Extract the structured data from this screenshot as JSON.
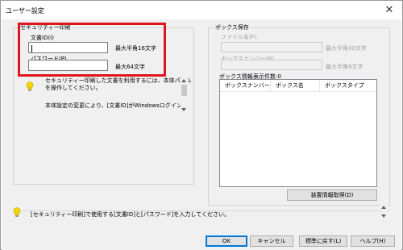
{
  "window": {
    "title": "ユーザー設定",
    "close_symbol": "✕"
  },
  "security_print": {
    "group_title": "セキュリティー印刷",
    "doc_id_label": "文書ID(I)",
    "doc_id_value": "",
    "doc_id_limit": "最大半角16文字",
    "password_label": "パスワード(P)",
    "password_value": "",
    "password_limit": "最大64文字"
  },
  "info_note": {
    "line1": "セキュリティー印刷した文書を利用するには、本体パネル",
    "line2": "を操作してください。",
    "line3": "本体設定の変更により、[文書ID]がWindowsログインID"
  },
  "box_save": {
    "group_title": "ボックス保存",
    "file_name_label": "ファイル名(F)",
    "file_name_limit": "最大半角30文字",
    "box_number_label": "ボックスナンバー(B)",
    "box_number_limit": "最大半角9文字",
    "box_info_label": "ボックス情報",
    "display_count": "表示件数:0",
    "columns": [
      "ボックスナンバー",
      "ボックス名",
      "ボックスタイプ"
    ],
    "fetch_button": "装置情報取得(D)"
  },
  "hint": {
    "text": "[セキュリティー印刷]で使用する[文書ID]と[パスワード]を入力してください。"
  },
  "buttons": {
    "ok": "OK",
    "cancel": "キャンセル",
    "reset": "標準に戻す(L)",
    "help": "ヘルプ(H)"
  },
  "colors": {
    "highlight_frame": "#e0141e",
    "bulb": "#f5d800",
    "dialog_bg": "#f0f0f0"
  },
  "icons": {
    "bulb": "light-bulb-icon",
    "close": "close-icon"
  }
}
